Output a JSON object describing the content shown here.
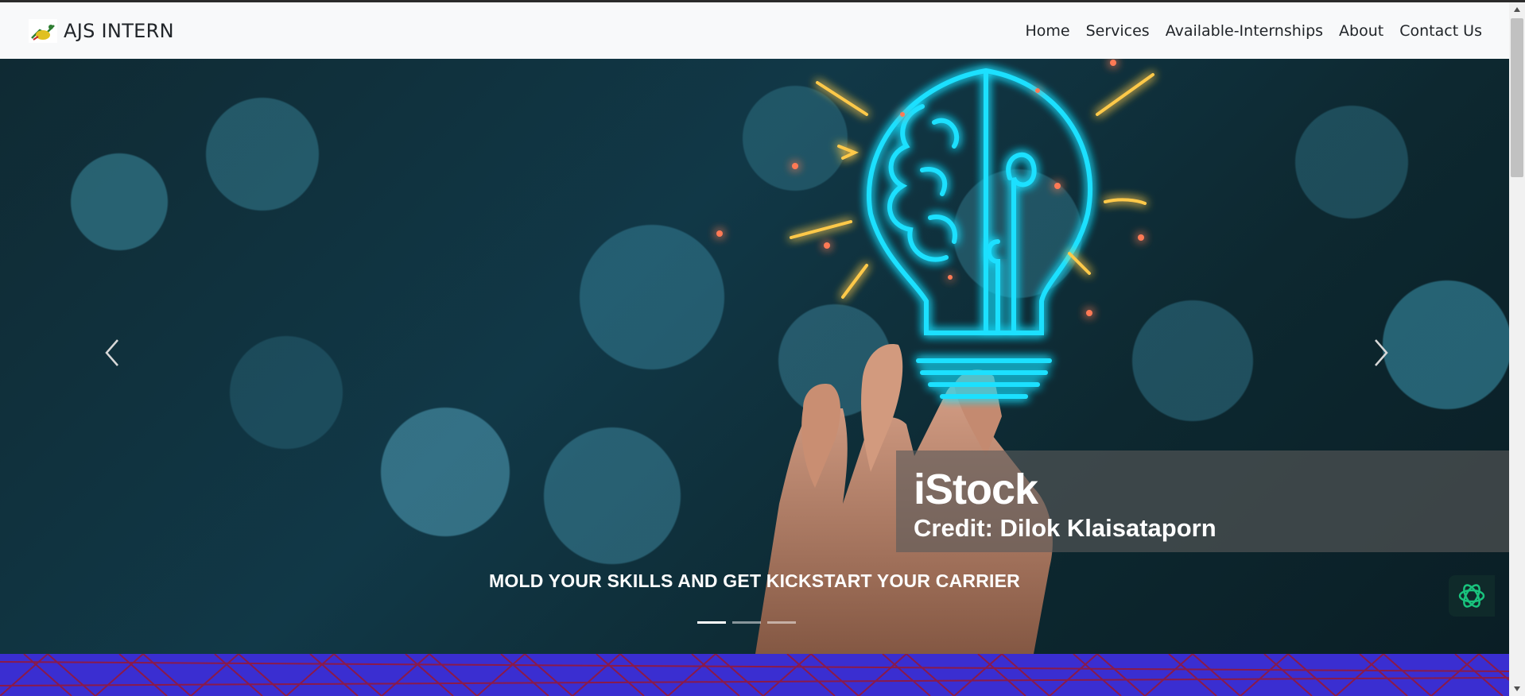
{
  "navbar": {
    "brand": "AJS INTERN",
    "links": [
      "Home",
      "Services",
      "Available-Internships",
      "About",
      "Contact Us"
    ]
  },
  "carousel": {
    "watermark": {
      "logo": "iStock",
      "credit": "Credit: Dilok Klaisataporn"
    },
    "caption": "MOLD YOUR SKILLS AND GET KICKSTART YOUR CARRIER",
    "active_slide": 1,
    "slide_count": 3
  },
  "colors": {
    "navbar_bg": "#f8f9fa",
    "pattern_band": "#3a2ed1",
    "pattern_lines": "#8a1a4a",
    "neon": "#1ee0ff",
    "spark": "#ffc94a"
  },
  "icons": {
    "brand": "logo-icon",
    "prev": "chevron-left-icon",
    "next": "chevron-right-icon",
    "chat": "openai-icon"
  }
}
